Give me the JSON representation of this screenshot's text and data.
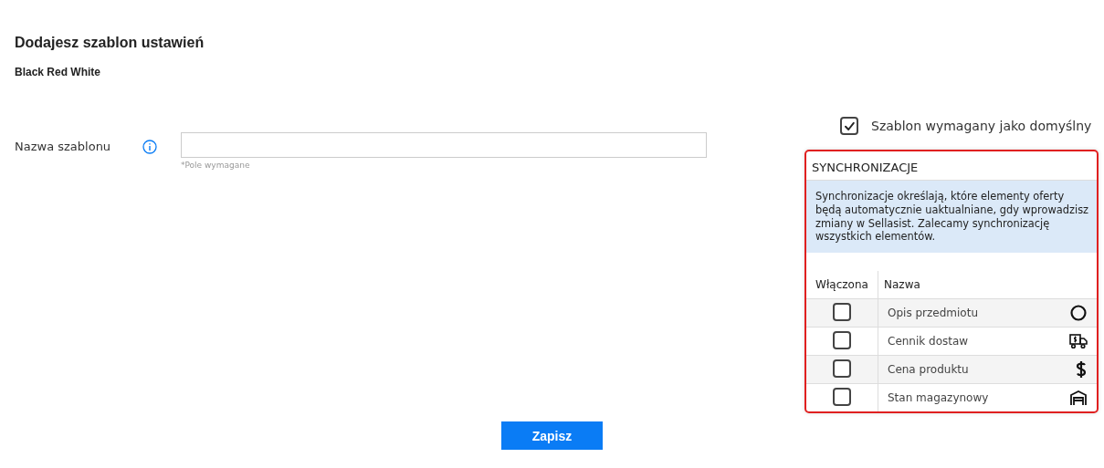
{
  "page": {
    "title": "Dodajesz szablon ustawień",
    "subtitle": "Black Red White"
  },
  "form": {
    "label": "Nazwa szablonu",
    "hint": "*Pole wymagane"
  },
  "default_checkbox": {
    "label": "Szablon wymagany jako domyślny",
    "checked": true
  },
  "sync_panel": {
    "title": "SYNCHRONIZACJE",
    "info": "Synchronizacje określają, które elementy oferty będą automatycznie uaktualniane, gdy wprowadzisz zmiany w Sellasist. Zalecamy synchronizację wszystkich elementów.",
    "columns": [
      "Włączona",
      "Nazwa"
    ],
    "rows": [
      {
        "name": "Opis przedmiotu",
        "checked": false,
        "kind": "circle"
      },
      {
        "name": "Cennik dostaw",
        "checked": false,
        "kind": "truck"
      },
      {
        "name": "Cena produktu",
        "checked": false,
        "kind": "dollar"
      },
      {
        "name": "Stan magazynowy",
        "checked": false,
        "kind": "warehouse"
      }
    ]
  },
  "buttons": [
    "Zapisz"
  ]
}
